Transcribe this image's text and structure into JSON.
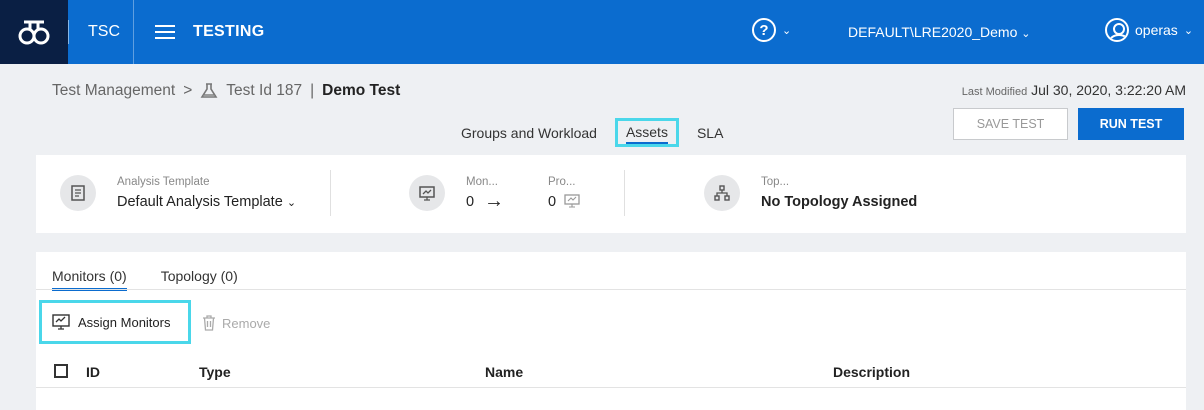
{
  "topbar": {
    "app_short": "TSC",
    "module": "TESTING",
    "domain": "DEFAULT\\LRE2020_Demo",
    "user": "operas"
  },
  "breadcrumb": {
    "root": "Test Management",
    "separator": ">",
    "test_id": "Test Id 187",
    "divider": "|",
    "test_name": "Demo Test"
  },
  "last_modified": {
    "label": "Last Modified",
    "value": "Jul 30, 2020, 3:22:20 AM"
  },
  "tabs": {
    "groups": "Groups and Workload",
    "assets": "Assets",
    "sla": "SLA"
  },
  "actions": {
    "save": "SAVE TEST",
    "run": "RUN TEST"
  },
  "summary": {
    "analysis_label": "Analysis Template",
    "analysis_value": "Default Analysis Template",
    "monitors_label": "Mon...",
    "monitors_value": "0",
    "profiles_label": "Pro...",
    "profiles_value": "0",
    "topology_label": "Top...",
    "topology_value": "No Topology Assigned"
  },
  "subtabs": {
    "monitors": "Monitors (0)",
    "topology": "Topology (0)"
  },
  "toolbar": {
    "assign": "Assign Monitors",
    "remove": "Remove"
  },
  "table": {
    "columns": [
      "ID",
      "Type",
      "Name",
      "Description"
    ]
  },
  "colors": {
    "brand": "#0b6ccf",
    "logo_bg": "#0a1f44",
    "highlight": "#4ad7ea"
  }
}
